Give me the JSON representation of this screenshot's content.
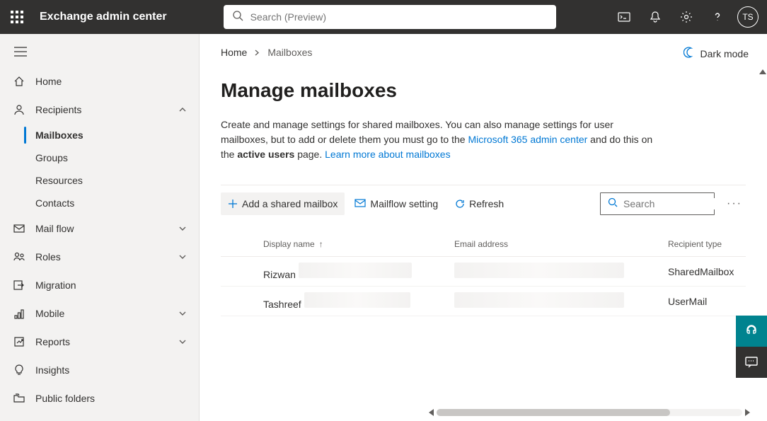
{
  "header": {
    "brand": "Exchange admin center",
    "search_placeholder": "Search (Preview)",
    "avatar_initials": "TS"
  },
  "sidebar": {
    "items": [
      {
        "icon": "home",
        "label": "Home",
        "chevron": null
      },
      {
        "icon": "person",
        "label": "Recipients",
        "chevron": "up",
        "children": [
          {
            "label": "Mailboxes",
            "selected": true
          },
          {
            "label": "Groups",
            "selected": false
          },
          {
            "label": "Resources",
            "selected": false
          },
          {
            "label": "Contacts",
            "selected": false
          }
        ]
      },
      {
        "icon": "mail",
        "label": "Mail flow",
        "chevron": "down"
      },
      {
        "icon": "roles",
        "label": "Roles",
        "chevron": "down"
      },
      {
        "icon": "migration",
        "label": "Migration",
        "chevron": null
      },
      {
        "icon": "mobile",
        "label": "Mobile",
        "chevron": "down"
      },
      {
        "icon": "reports",
        "label": "Reports",
        "chevron": "down"
      },
      {
        "icon": "insights",
        "label": "Insights",
        "chevron": null
      },
      {
        "icon": "folders",
        "label": "Public folders",
        "chevron": null
      }
    ]
  },
  "breadcrumb": {
    "home": "Home",
    "current": "Mailboxes"
  },
  "dark_mode_label": "Dark mode",
  "page": {
    "title": "Manage mailboxes",
    "desc_1": "Create and manage settings for shared mailboxes. You can also manage settings for user mailboxes, but to add or delete them you must go to the ",
    "link_1": "Microsoft 365 admin center",
    "desc_2": " and do this on the ",
    "bold_1": "active users",
    "desc_3": " page. ",
    "link_2": "Learn more about mailboxes"
  },
  "toolbar": {
    "add": "Add a shared mailbox",
    "mailflow": "Mailflow setting",
    "refresh": "Refresh",
    "search_placeholder": "Search"
  },
  "table": {
    "columns": {
      "name": "Display name",
      "email": "Email address",
      "type": "Recipient type"
    },
    "rows": [
      {
        "name": "Rizwan",
        "type": "SharedMailbox"
      },
      {
        "name": "Tashreef",
        "type": "UserMail"
      }
    ]
  }
}
